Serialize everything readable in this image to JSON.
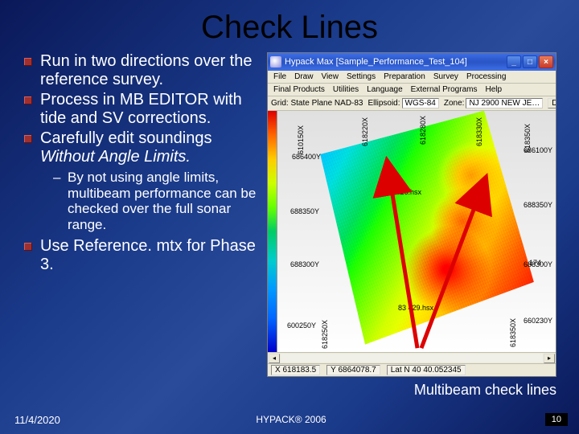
{
  "title": "Check Lines",
  "bullets": {
    "b1": "Run in two directions over the reference survey.",
    "b2": "Process in MB EDITOR with tide and SV corrections.",
    "b3_pre": "Carefully edit soundings ",
    "b3_em": "Without Angle Limits.",
    "sub1": "By not using angle limits, multibeam performance can be checked over the full sonar range.",
    "b4": "Use Reference. mtx for Phase 3."
  },
  "app": {
    "title_label": "Hypack Max  [Sample_Performance_Test_104]",
    "menus": {
      "file": "File",
      "draw": "Draw",
      "view": "View",
      "settings": "Settings",
      "preparation": "Preparation",
      "survey": "Survey",
      "processing": "Processing",
      "final": "Final Products",
      "utilities": "Utilities",
      "language": "Language",
      "external": "External Programs",
      "help": "Help"
    },
    "info": {
      "grid_lbl": "Grid: State Plane NAD-83",
      "ellipsoid_lbl": "Ellipsoid:",
      "ellipsoid_val": "WGS-84",
      "zone_lbl": "Zone:",
      "zone_val": "NJ 2900 NEW JE…",
      "dist_btn": "Dist…"
    },
    "edge_labels": {
      "x_l1": "610150X",
      "x_l2": "618220X",
      "x_l3": "618280X",
      "x_l4": "618330X",
      "x_l5": "618350X",
      "y_r1": "686100Y",
      "y_r2": "686400Y",
      "y_r3": "688350Y",
      "y_r4": "688300Y",
      "y_r5": "688300Y",
      "y_r6": "660230Y",
      "y_l1": "600250Y",
      "ann1": "008 1426.hsx",
      "ann2": "174",
      "ann3": "83  429.hsx",
      "bx1": "618250X",
      "bx2": "618350X"
    },
    "status": {
      "x_lbl": "X",
      "x_val": "618183.5",
      "y_lbl": "Y",
      "y_val": "6864078.7",
      "lat_lbl": "Lat",
      "lat_val": "N 40 40.052345"
    }
  },
  "caption": "Multibeam check lines",
  "footer": {
    "date": "11/4/2020",
    "copy": "HYPACK® 2006",
    "page": "10"
  }
}
